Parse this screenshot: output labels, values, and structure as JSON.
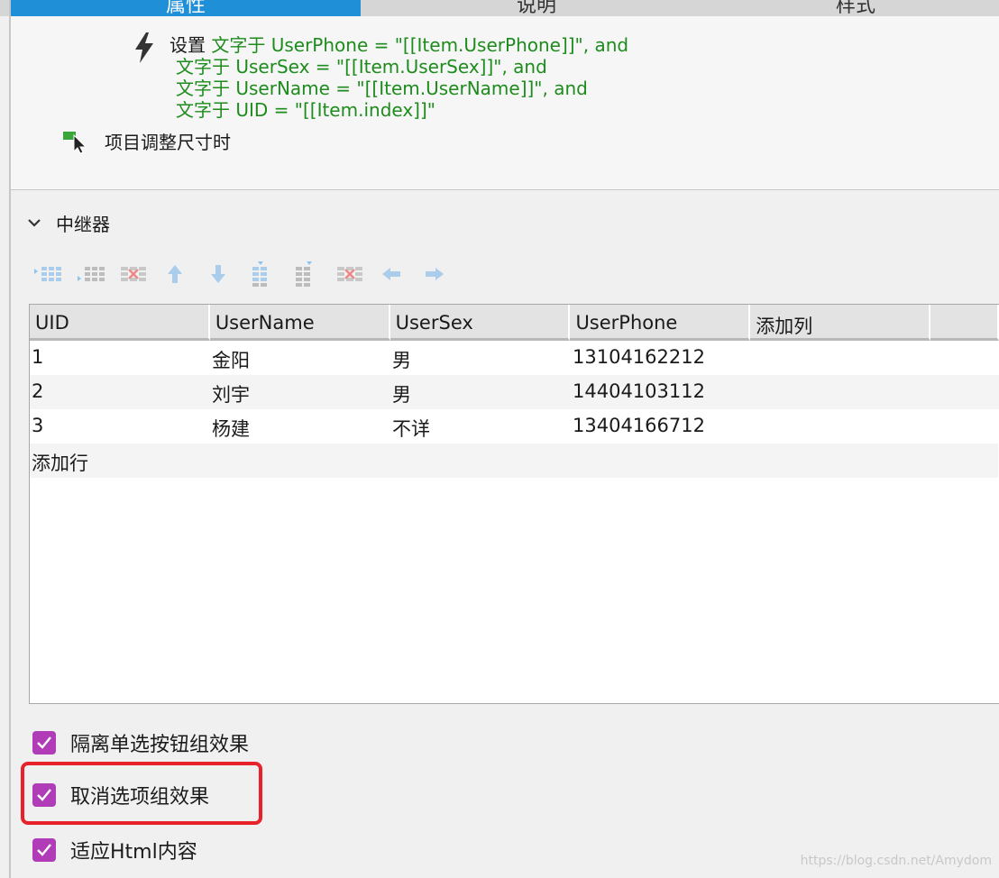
{
  "tabs": [
    {
      "label": "属性"
    },
    {
      "label": "说明"
    },
    {
      "label": "样式"
    }
  ],
  "interaction": {
    "action_keyword": "设置",
    "action_lines": [
      "文字于 UserPhone = \"[[Item.UserPhone]]\", and",
      "文字于 UserSex = \"[[Item.UserSex]]\", and",
      "文字于 UserName = \"[[Item.UserName]]\", and",
      "文字于 UID = \"[[Item.index]]\""
    ],
    "event_label": "项目调整尺寸时"
  },
  "repeater": {
    "title": "中继器",
    "toolbar_icons": [
      "insert-row-icon",
      "add-row-icon",
      "delete-row-icon",
      "move-up-icon",
      "move-down-icon",
      "insert-column-before-icon",
      "insert-column-after-icon",
      "delete-column-icon",
      "move-left-icon",
      "move-right-icon"
    ],
    "columns": [
      "UID",
      "UserName",
      "UserSex",
      "UserPhone",
      "添加列",
      ""
    ],
    "rows": [
      [
        "1",
        "金阳",
        "男",
        "13104162212"
      ],
      [
        "2",
        "刘宇",
        "男",
        "14404103112"
      ],
      [
        "3",
        "杨建",
        "不详",
        "13404166712"
      ]
    ],
    "add_row_label": "添加行"
  },
  "options": [
    {
      "label": "隔离单选按钮组效果",
      "checked": true
    },
    {
      "label": "取消选项组效果",
      "checked": true
    },
    {
      "label": "适应Html内容",
      "checked": true
    }
  ],
  "watermark": "https://blog.csdn.net/Amydom",
  "colors": {
    "active_tab": "#1f8fd8",
    "action_text": "#1d8c1d",
    "checkbox": "#b03cb8",
    "highlight": "#e8222a"
  }
}
